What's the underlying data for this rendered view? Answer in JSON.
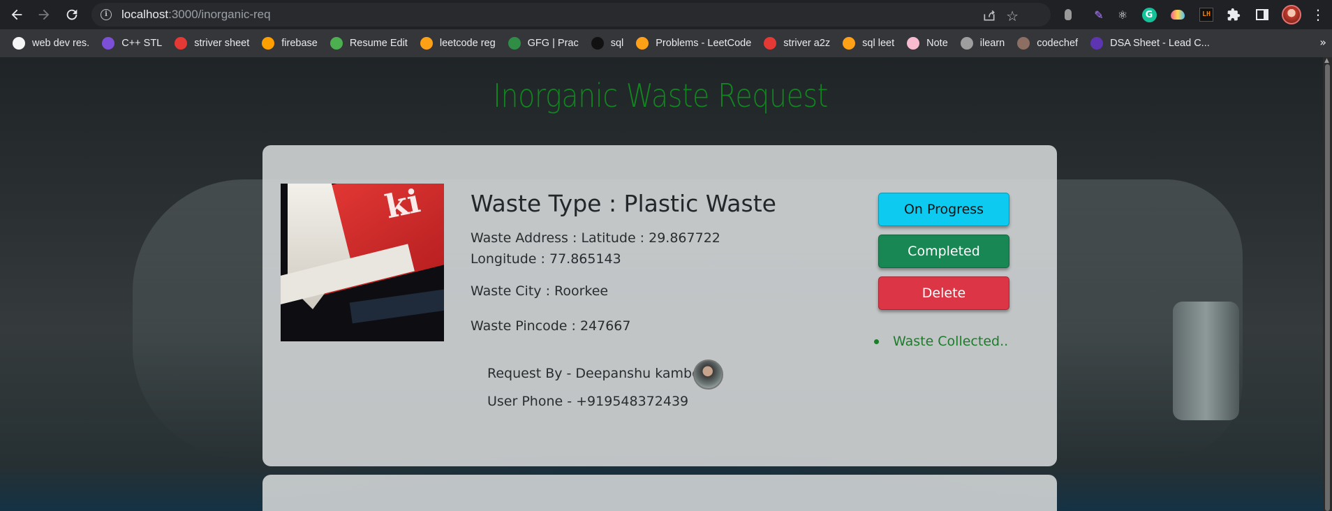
{
  "browser": {
    "url_host": "localhost",
    "url_path": ":3000/inorganic-req",
    "bookmarks": [
      {
        "label": "web dev res.",
        "color": "#f5f5f5"
      },
      {
        "label": "C++ STL",
        "color": "#7b4fd6"
      },
      {
        "label": "striver sheet",
        "color": "#e53935"
      },
      {
        "label": "firebase",
        "color": "#ffa000"
      },
      {
        "label": "Resume Edit",
        "color": "#4caf50"
      },
      {
        "label": "leetcode reg",
        "color": "#ffa116"
      },
      {
        "label": "GFG | Prac",
        "color": "#2f8d46"
      },
      {
        "label": "sql",
        "color": "#111111"
      },
      {
        "label": "Problems - LeetCode",
        "color": "#ffa116"
      },
      {
        "label": "striver a2z",
        "color": "#e53935"
      },
      {
        "label": "sql leet",
        "color": "#ffa116"
      },
      {
        "label": "Note",
        "color": "#f8bbd0"
      },
      {
        "label": "ilearn",
        "color": "#9e9e9e"
      },
      {
        "label": "codechef",
        "color": "#8d6e63"
      },
      {
        "label": "DSA Sheet - Lead C...",
        "color": "#5e35b1"
      }
    ]
  },
  "page": {
    "title": "Inorganic Waste Request"
  },
  "request": {
    "waste_type": "Waste Type : Plastic Waste",
    "address": "Waste Address : Latitude : 29.867722 Longitude : 77.865143",
    "city": "Waste City : Roorkee",
    "pincode": "Waste Pincode : 247667",
    "request_by": "Request By - Deepanshu kamboj",
    "user_phone": "User Phone - +919548372439",
    "image_brand_text": "ki",
    "buttons": {
      "progress": "On Progress",
      "completed": "Completed",
      "delete": "Delete"
    },
    "status": "Waste Collected.."
  }
}
